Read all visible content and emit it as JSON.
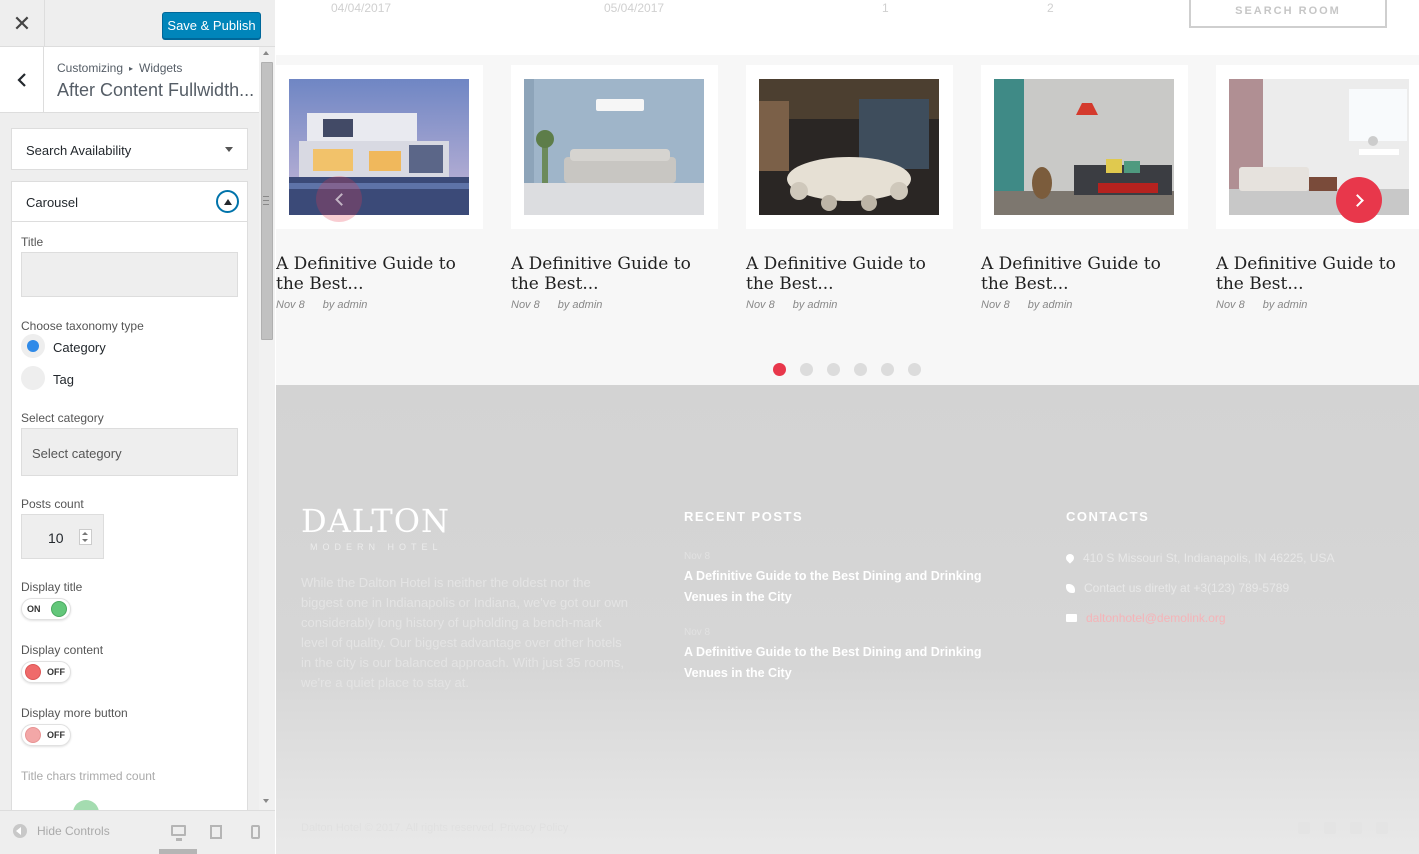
{
  "topbar": {
    "close_glyph": "✕",
    "publish_label": "Save & Publish"
  },
  "panel": {
    "breadcrumb_root": "Customizing",
    "breadcrumb_sep": "▸",
    "breadcrumb_section": "Widgets",
    "title": "After Content Fullwidth..."
  },
  "sections": {
    "search": {
      "title": "Search Availability"
    },
    "carousel": {
      "title": "Carousel",
      "title_label": "Title",
      "title_value": "",
      "taxonomy_label": "Choose taxonomy type",
      "taxonomy_options": [
        {
          "label": "Category",
          "checked": true
        },
        {
          "label": "Tag",
          "checked": false
        }
      ],
      "category_label": "Select category",
      "category_placeholder": "Select category",
      "posts_count_label": "Posts count",
      "posts_count": "10",
      "display_title_label": "Display title",
      "display_title_state": "ON",
      "display_content_label": "Display content",
      "display_content_state": "OFF",
      "display_more_label": "Display more button",
      "display_more_state": "OFF",
      "trim_label": "Title chars trimmed count"
    }
  },
  "footer_controls": {
    "hide_label": "Hide Controls"
  },
  "preview": {
    "booking": {
      "checkin": "04/04/2017",
      "checkout": "05/04/2017",
      "adults": "1",
      "children": "2",
      "search_label": "SEARCH ROOM"
    },
    "carousel": {
      "cards": [
        {
          "title": "A Definitive Guide to the Best...",
          "date": "Nov 8",
          "author": "by admin",
          "image": "modern-house"
        },
        {
          "title": "A Definitive Guide to the Best...",
          "date": "Nov 8",
          "author": "by admin",
          "image": "blue-living-room"
        },
        {
          "title": "A Definitive Guide to the Best...",
          "date": "Nov 8",
          "author": "by admin",
          "image": "dining-hall"
        },
        {
          "title": "A Definitive Guide to the Best...",
          "date": "Nov 8",
          "author": "by admin",
          "image": "teal-lounge"
        },
        {
          "title": "A Definitive Guide to the Best...",
          "date": "Nov 8",
          "author": "by admin",
          "image": "white-apartment"
        }
      ],
      "dots": 6,
      "active_dot": 0,
      "accent_color": "#e8374b"
    },
    "footer": {
      "logo_text": "DALTON",
      "logo_sub": "MODERN HOTEL",
      "about": "While the Dalton Hotel is neither the oldest nor the biggest one in Indianapolis or Indiana, we've got our own considerably long history of upholding a bench-mark level of quality. Our biggest advantage over other hotels in the city is our balanced approach. With just 35 rooms, we're a quiet place to stay at.",
      "recent_heading": "RECENT POSTS",
      "posts": [
        {
          "date": "Nov 8",
          "title": "A Definitive Guide to the Best Dining and Drinking Venues in the City"
        },
        {
          "date": "Nov 8",
          "title": "A Definitive Guide to the Best Dining and Drinking Venues in the City"
        }
      ],
      "contacts_heading": "CONTACTS",
      "address": "410 S Missouri St, Indianapolis, IN 46225, USA",
      "phone": "Contact us diretly at +3(123) 789-5789",
      "email": "daltonhotel@demolink.org",
      "copyright": "Dalton Hotel © 2017. All rights reserved. Privacy Policy",
      "social_icons": [
        "facebook-icon",
        "twitter-icon",
        "google-plus-icon",
        "instagram-icon"
      ]
    }
  }
}
